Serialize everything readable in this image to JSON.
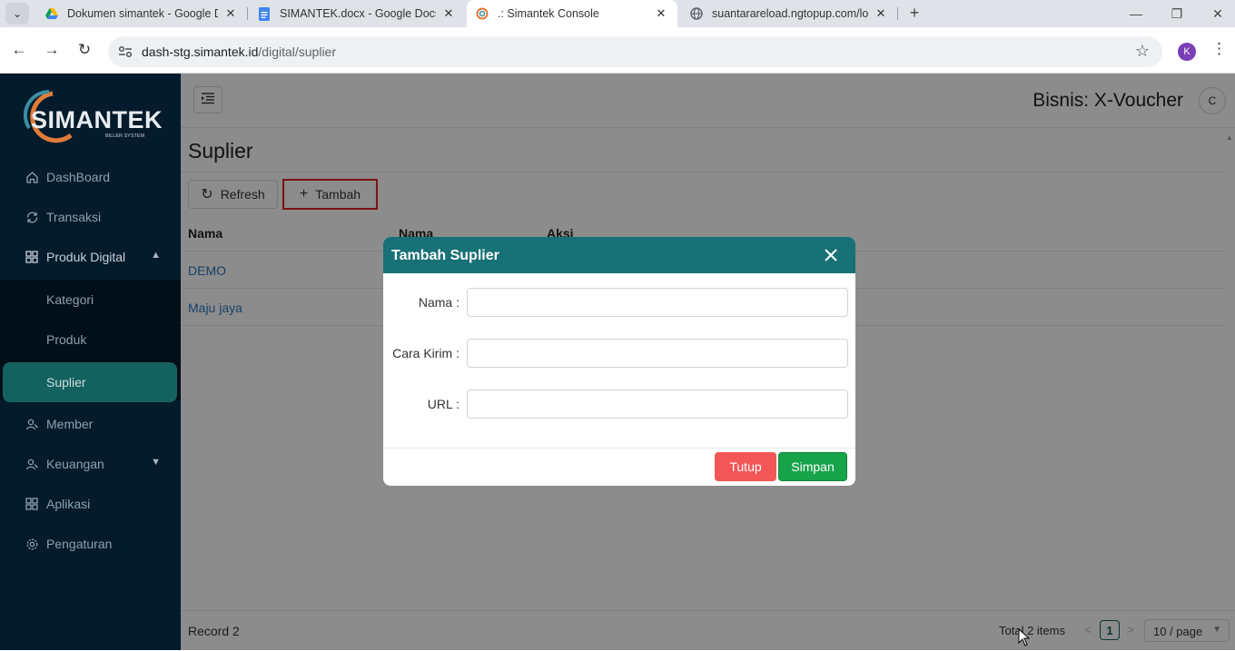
{
  "browser": {
    "tabs": [
      {
        "title": "Dokumen simantek - Google Dri",
        "icon": "google-drive-icon"
      },
      {
        "title": "SIMANTEK.docx - Google Docs",
        "icon": "google-docs-icon"
      },
      {
        "title": ".: Simantek Console",
        "icon": "simantek-icon",
        "active": true
      },
      {
        "title": "suantarareload.ngtopup.com/lo",
        "icon": "globe-icon"
      }
    ],
    "address": {
      "host": "dash-stg.simantek.id",
      "path": "/digital/suplier"
    },
    "profile_initial": "K"
  },
  "sidebar": {
    "logo_text": "SIMANTEK",
    "logo_subtext": "BILLER SYSTEM",
    "items": [
      {
        "label": "DashBoard",
        "icon": "home-icon"
      },
      {
        "label": "Transaksi",
        "icon": "sync-icon"
      },
      {
        "label": "Produk Digital",
        "icon": "grid-icon",
        "expanded": true
      },
      {
        "label": "Member",
        "icon": "users-icon"
      },
      {
        "label": "Keuangan",
        "icon": "users-icon"
      },
      {
        "label": "Aplikasi",
        "icon": "grid-icon"
      },
      {
        "label": "Pengaturan",
        "icon": "gear-icon"
      }
    ],
    "submenu": [
      {
        "label": "Kategori"
      },
      {
        "label": "Produk"
      },
      {
        "label": "Suplier",
        "active": true
      }
    ]
  },
  "header": {
    "business": "Bisnis: X-Voucher",
    "avatar_initial": "C"
  },
  "page": {
    "title": "Suplier",
    "refresh_label": "Refresh",
    "add_label": "Tambah",
    "columns": [
      "Nama",
      "Nama",
      "Aksi"
    ],
    "rows": [
      {
        "name": "DEMO"
      },
      {
        "name": "Maju jaya"
      }
    ],
    "record_text": "Record 2",
    "total_text": "Total 2 items",
    "current_page": "1",
    "page_size": "10 / page"
  },
  "modal": {
    "title": "Tambah Suplier",
    "fields": [
      {
        "label": "Nama :",
        "value": ""
      },
      {
        "label": "Cara Kirim :",
        "value": ""
      },
      {
        "label": "URL :",
        "value": ""
      }
    ],
    "close_label": "Tutup",
    "save_label": "Simpan"
  },
  "colors": {
    "sidebar_bg": "#031b2b",
    "accent": "#14625f",
    "modal_header": "#177176",
    "danger": "#f25656",
    "success": "#16a34a",
    "highlight_border": "#e02424"
  }
}
